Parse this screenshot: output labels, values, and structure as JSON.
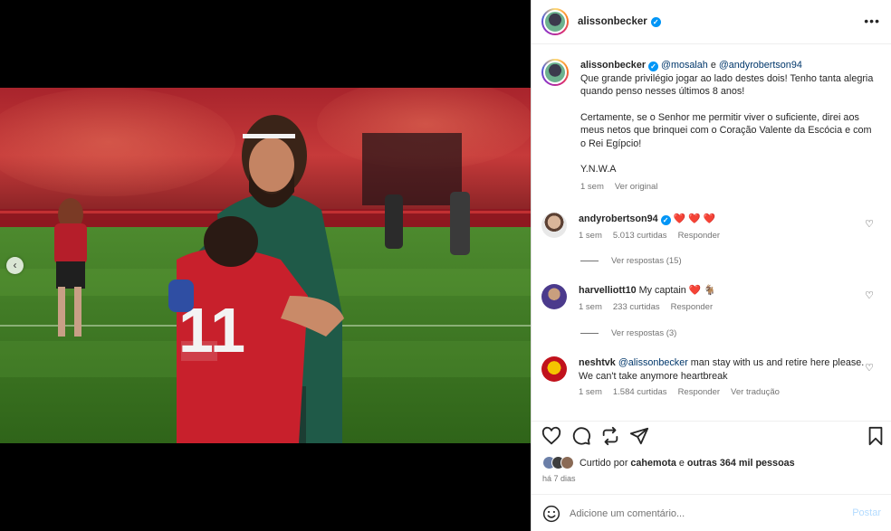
{
  "post": {
    "author": "alissonbecker",
    "more_label": "•••"
  },
  "caption": {
    "author": "alissonbecker",
    "mention1": "@mosalah",
    "joiner": "e",
    "mention2": "@andyrobertson94",
    "line1": "Que grande privilégio jogar ao lado destes dois! Tenho tanta alegria quando penso nesses últimos 8 anos!",
    "line2": "Certamente, se o Senhor me permitir viver o suficiente, direi aos meus netos que brinquei com o Coração Valente da Escócia e com o Rei Egípcio!",
    "line3": "Y.N.W.A",
    "time": "1 sem",
    "see_original": "Ver original"
  },
  "comments": [
    {
      "author": "andyrobertson94",
      "verified": true,
      "text": "❤️ ❤️ ❤️",
      "time": "1 sem",
      "likes": "5.013 curtidas",
      "reply": "Responder",
      "replies": "Ver respostas (15)"
    },
    {
      "author": "harvelliott10",
      "text": "My captain ❤️ 🐐",
      "time": "1 sem",
      "likes": "233 curtidas",
      "reply": "Responder",
      "replies": "Ver respostas (3)"
    },
    {
      "author": "neshtvk",
      "mention": "@alissonbecker",
      "text": "man stay with us and retire here please. We can't take anymore heartbreak",
      "time": "1 sem",
      "likes": "1.584 curtidas",
      "reply": "Responder",
      "translate": "Ver tradução"
    }
  ],
  "likes": {
    "prefix": "Curtido por",
    "user": "cahemota",
    "joiner": "e",
    "others": "outras 364 mil pessoas"
  },
  "posted_ago": "há 7 dias",
  "comment_box": {
    "placeholder": "Adicione um comentário...",
    "post_label": "Postar"
  },
  "icons": {
    "carousel_prev": "‹",
    "verified": "✓",
    "heart": "♡"
  },
  "colors": {
    "link": "#00376b",
    "verified": "#0095f6",
    "heart": "#ed4956",
    "post_button": "#b3dbff"
  }
}
